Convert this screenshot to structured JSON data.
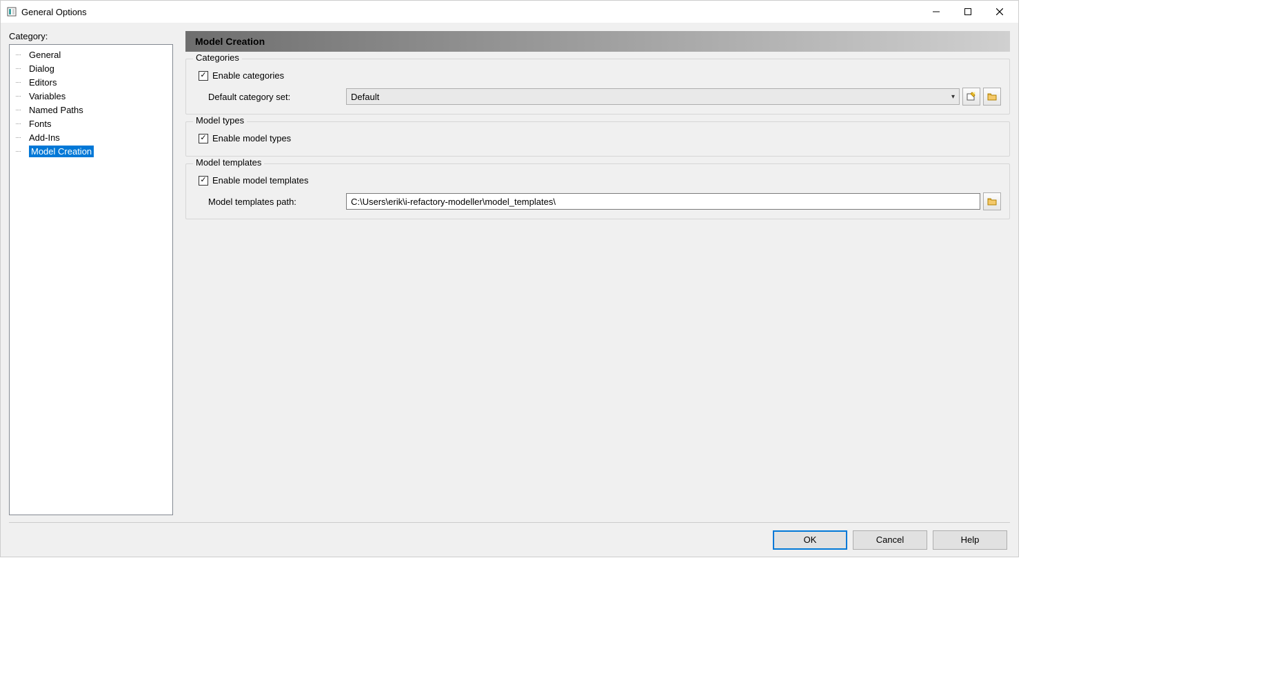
{
  "window": {
    "title": "General Options"
  },
  "sidebar": {
    "label": "Category:",
    "items": [
      {
        "label": "General"
      },
      {
        "label": "Dialog"
      },
      {
        "label": "Editors"
      },
      {
        "label": "Variables"
      },
      {
        "label": "Named Paths"
      },
      {
        "label": "Fonts"
      },
      {
        "label": "Add-Ins"
      },
      {
        "label": "Model Creation"
      }
    ],
    "selected_index": 7
  },
  "page": {
    "title": "Model Creation",
    "categories": {
      "legend": "Categories",
      "enable_label": "Enable categories",
      "enable_checked": true,
      "default_label": "Default category set:",
      "default_value": "Default"
    },
    "model_types": {
      "legend": "Model types",
      "enable_label": "Enable model types",
      "enable_checked": true
    },
    "templates": {
      "legend": "Model templates",
      "enable_label": "Enable model templates",
      "enable_checked": true,
      "path_label": "Model templates path:",
      "path_value": "C:\\Users\\erik\\i-refactory-modeller\\model_templates\\"
    }
  },
  "buttons": {
    "ok": "OK",
    "cancel": "Cancel",
    "help": "Help"
  }
}
